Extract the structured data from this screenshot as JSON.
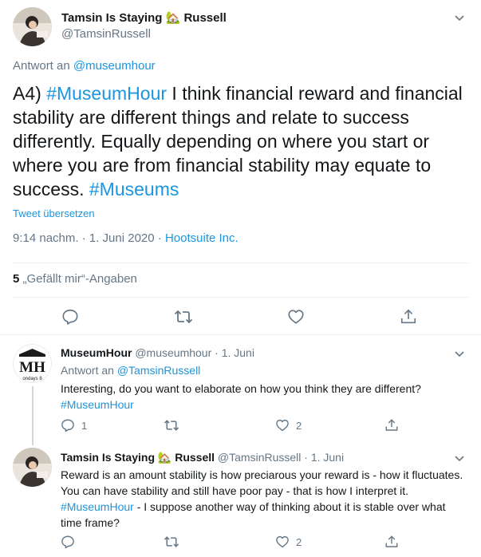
{
  "main": {
    "name_part1": "Tamsin Is Staying",
    "house_emoji": "🏡",
    "name_part2": "Russell",
    "handle": "@TamsinRussell",
    "reply_prefix": "Antwort an",
    "reply_to": "@museumhour",
    "text": [
      {
        "t": "A4) ",
        "h": false
      },
      {
        "t": "#MuseumHour",
        "h": true
      },
      {
        "t": " I think financial reward and financial stability are different things and relate to success differently. Equally depending on where you start or where you are from financial stability may equate to success. ",
        "h": false
      },
      {
        "t": "#Museums",
        "h": true
      }
    ],
    "translate": "Tweet übersetzen",
    "timestamp": "9:14 nachm. · 1. Juni 2020 ·",
    "source": "Hootsuite Inc.",
    "likes_count": "5",
    "likes_label": "„Gefällt mir“-Angaben"
  },
  "replies": [
    {
      "name": "MuseumHour",
      "handle": "@museumhour",
      "date": "· 1. Juni",
      "reply_prefix": "Antwort an",
      "reply_to": "@TamsinRussell",
      "avatar_text": "MH",
      "avatar_sub": "ondays 8",
      "text": [
        {
          "t": "Interesting, do you want to elaborate on how you think they are different? ",
          "h": false
        },
        {
          "t": "#MuseumHour",
          "h": true
        }
      ],
      "reply_count": "1",
      "retweet_count": "",
      "like_count": "2"
    },
    {
      "name_part1": "Tamsin Is Staying",
      "house_emoji": "🏡",
      "name_part2": "Russell",
      "handle": "@TamsinRussell",
      "date": "· 1. Juni",
      "text": [
        {
          "t": "Reward is an amount stability is how preciarous your reward is - how it fluctuates. You can have stability and still have poor pay - that is how I interpret it. ",
          "h": false
        },
        {
          "t": "#MuseumHour",
          "h": true
        },
        {
          "t": " - I suppose another way of thinking about it is stable over what time frame?",
          "h": false
        }
      ],
      "reply_count": "",
      "retweet_count": "",
      "like_count": "2"
    }
  ],
  "colors": {
    "link": "#1b95e0",
    "muted": "#657786",
    "text": "#14171a",
    "border": "#e6ecf0"
  },
  "icons": [
    "chevron-down-icon",
    "reply-icon",
    "retweet-icon",
    "like-icon",
    "share-icon",
    "house-emoji-icon"
  ]
}
